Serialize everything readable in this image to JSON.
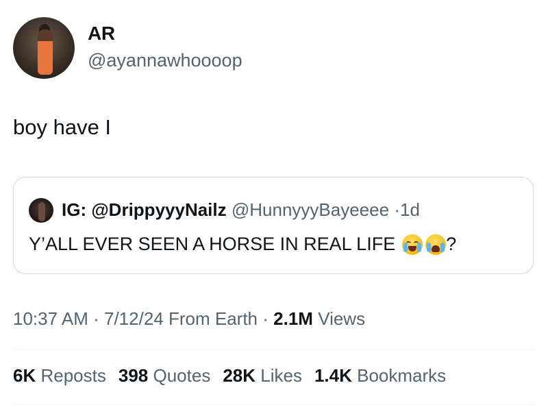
{
  "author": {
    "display_name": "AR",
    "handle": "@ayannawhoooop"
  },
  "tweet": {
    "text": "boy have I"
  },
  "quoted_tweet": {
    "display_name": "IG: @DrippyyyNailz",
    "handle": "@HunnyyyBayeeee",
    "separator": "·",
    "age": "1d",
    "text": "Y’ALL EVER SEEN A HORSE IN REAL LIFE",
    "emojis": [
      "laughing-tears-emoji",
      "crying-face-emoji"
    ],
    "trailing": "?"
  },
  "meta": {
    "time": "10:37 AM",
    "sep1": "·",
    "date": "7/12/24",
    "source": "From Earth",
    "sep2": "·",
    "views_count": "2.1M",
    "views_label": "Views"
  },
  "stats": [
    {
      "count": "6K",
      "label": "Reposts"
    },
    {
      "count": "398",
      "label": "Quotes"
    },
    {
      "count": "28K",
      "label": "Likes"
    },
    {
      "count": "1.4K",
      "label": "Bookmarks"
    }
  ]
}
